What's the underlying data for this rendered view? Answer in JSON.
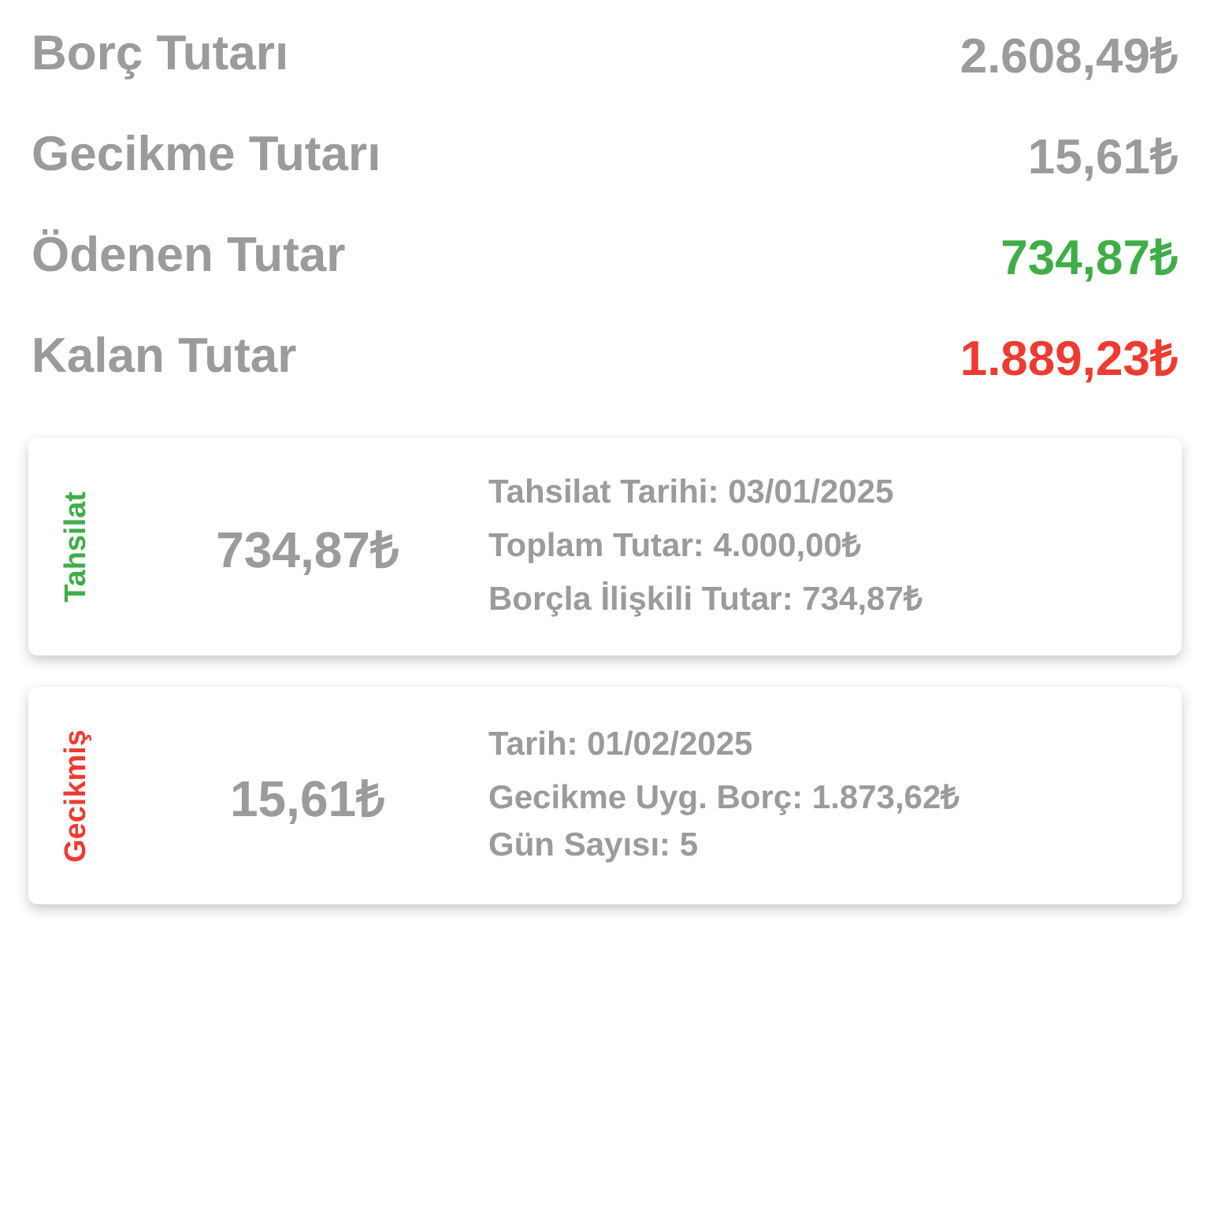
{
  "summary": [
    {
      "label": "Borç Tutarı",
      "amount": "2.608,49₺",
      "color": "#9b9b9b"
    },
    {
      "label": "Gecikme Tutarı",
      "amount": "15,61₺",
      "color": "#9b9b9b"
    },
    {
      "label": "Ödenen Tutar",
      "amount": "734,87₺",
      "color": "#3fae48"
    },
    {
      "label": "Kalan Tutar",
      "amount": "1.889,23₺",
      "color": "#ee3b32"
    }
  ],
  "cards": [
    {
      "tag": "Tahsilat",
      "color": "#3fae48",
      "amount": "734,87₺",
      "details": [
        "Tahsilat Tarihi: 03/01/2025",
        "Toplam Tutar: 4.000,00₺",
        "Borçla İlişkili Tutar: 734,87₺"
      ]
    },
    {
      "tag": "Gecikmiş",
      "color": "#ee3b32",
      "amount": "15,61₺",
      "details": [
        "Tarih: 01/02/2025",
        "Gecikme Uyg. Borç: 1.873,62₺",
        "Gün Sayısı: 5"
      ]
    }
  ]
}
